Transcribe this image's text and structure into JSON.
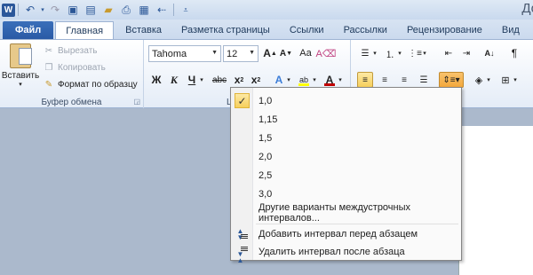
{
  "window": {
    "title": "До",
    "app_logo": "W",
    "quick_access": [
      "save-icon",
      "undo-icon",
      "redo-icon",
      "open-icon",
      "new-icon",
      "print-icon",
      "picture-icon",
      "customize-icon"
    ]
  },
  "tabs": [
    {
      "label": "Файл"
    },
    {
      "label": "Главная"
    },
    {
      "label": "Вставка"
    },
    {
      "label": "Разметка страницы"
    },
    {
      "label": "Ссылки"
    },
    {
      "label": "Рассылки"
    },
    {
      "label": "Рецензирование"
    },
    {
      "label": "Вид"
    }
  ],
  "clipboard": {
    "paste_label": "Вставить",
    "cut_label": "Вырезать",
    "copy_label": "Копировать",
    "format_painter_label": "Формат по образцу",
    "group_label": "Буфер обмена"
  },
  "font": {
    "name": "Tahoma",
    "size": "12",
    "bold": "Ж",
    "italic": "К",
    "underline": "Ч",
    "strike": "abc",
    "subscript": "x",
    "group_label_partial": "L"
  },
  "line_spacing_menu": {
    "options": [
      "1,0",
      "1,15",
      "1,5",
      "2,0",
      "2,5",
      "3,0"
    ],
    "selected": "1,0",
    "more_options": "Другие варианты междустрочных интервалов...",
    "add_before": "Добавить интервал перед абзацем",
    "remove_after": "Удалить интервал после абзаца"
  },
  "colors": {
    "accent": "#2b579a",
    "highlight": "#f6cf5c",
    "font_color": "#c00000",
    "highlight_color": "#ffff00"
  }
}
